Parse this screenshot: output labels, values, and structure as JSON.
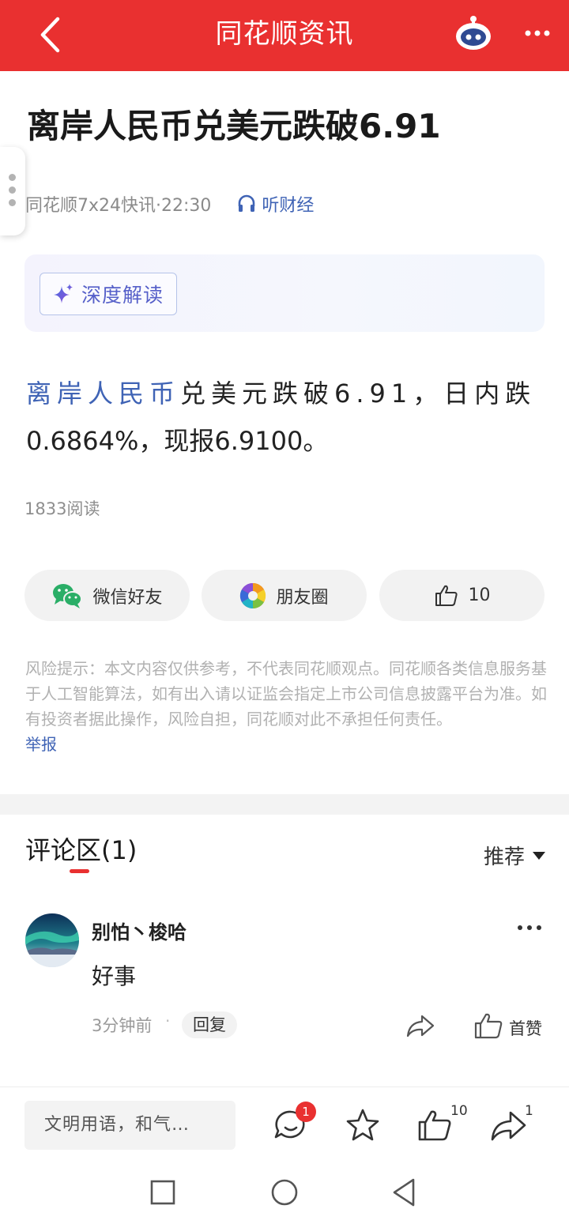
{
  "header": {
    "title": "同花顺资讯"
  },
  "article": {
    "title": "离岸人民币兑美元跌破6.91",
    "source": "同花顺7x24快讯·22:30",
    "listen_label": "听财经",
    "ai_label": "深度解读",
    "content_keyword": "离岸人民币",
    "content_rest_line1": "兑美元跌破6.91，日内跌",
    "content_line2": "0.6864%，现报6.9100。",
    "reads": "1833阅读"
  },
  "share": {
    "wechat_label": "微信好友",
    "moments_label": "朋友圈",
    "like_count": "10"
  },
  "disclaimer": "风险提示：本文内容仅供参考，不代表同花顺观点。同花顺各类信息服务基于人工智能算法，如有出入请以证监会指定上市公司信息披露平台为准。如有投资者据此操作，风险自担，同花顺对此不承担任何责任。",
  "report_label": "举报",
  "comments": {
    "header": "评论区(1)",
    "sort_label": "推荐",
    "items": [
      {
        "user": "别怕丶梭哈",
        "text": "好事",
        "time": "3分钟前",
        "reply_label": "回复",
        "like_label": "首赞"
      }
    ]
  },
  "bottom_bar": {
    "input_placeholder": "文明用语，和气…",
    "comment_badge": "1",
    "like_count": "10",
    "share_count": "1"
  },
  "colors": {
    "brand_red": "#e93030",
    "link_blue": "#3f63b5"
  }
}
